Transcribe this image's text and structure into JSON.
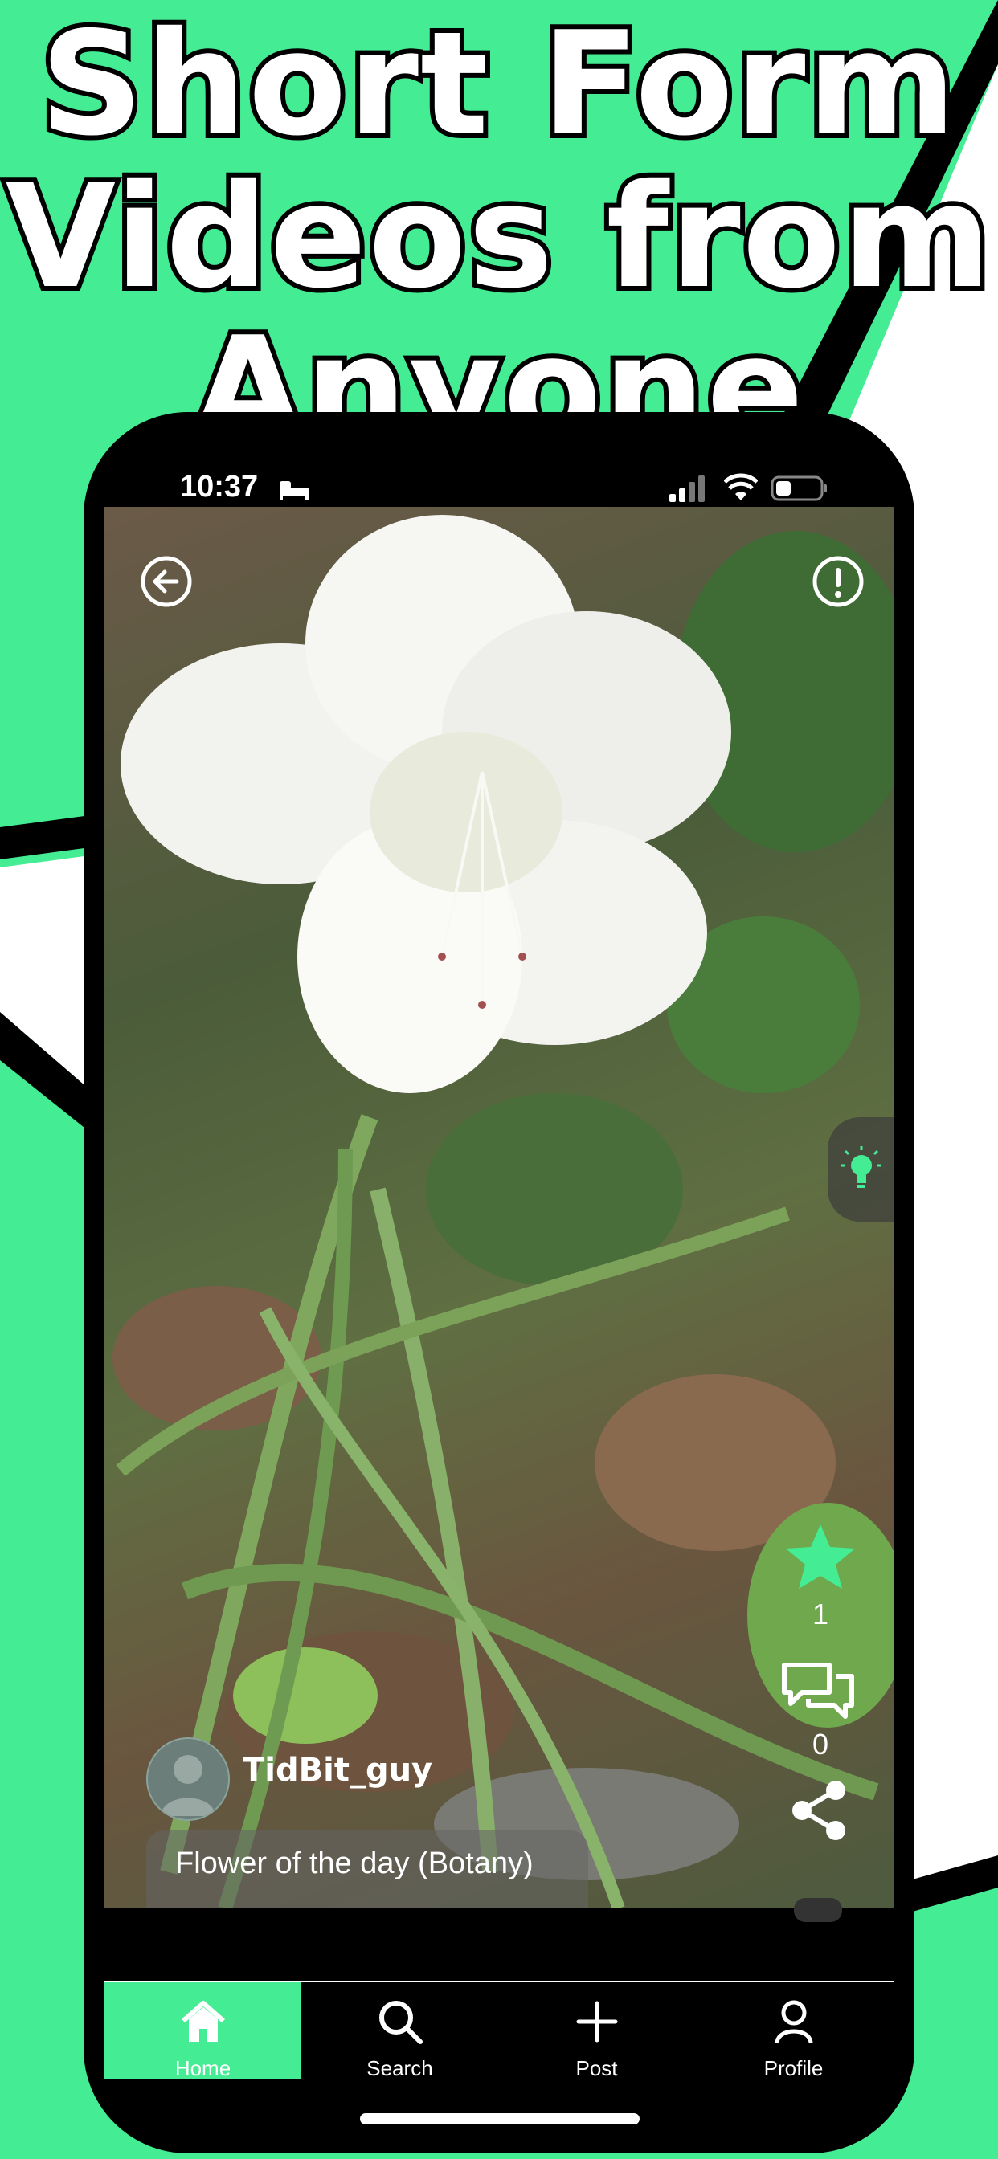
{
  "headline": [
    "Short Form",
    "Videos from",
    "Anyone"
  ],
  "status_bar": {
    "time": "10:37",
    "icons": [
      "bed-icon",
      "signal-icon",
      "wifi-icon",
      "battery-icon"
    ]
  },
  "video": {
    "subject": "white azalea flower",
    "back_icon": "back-arrow-icon",
    "report_icon": "report-icon",
    "side_tab_icon": "lightbulb-icon"
  },
  "actions": {
    "like_count": "1",
    "comment_count": "0",
    "icons": [
      "star-icon",
      "comment-icon",
      "share-icon"
    ]
  },
  "post": {
    "username": "TidBit_guy",
    "caption": "Flower of the day (Botany)"
  },
  "nav": {
    "items": [
      {
        "label": "Home",
        "icon": "home-icon",
        "active": true
      },
      {
        "label": "Search",
        "icon": "search-icon",
        "active": false
      },
      {
        "label": "Post",
        "icon": "plus-icon",
        "active": false
      },
      {
        "label": "Profile",
        "icon": "profile-icon",
        "active": false
      }
    ]
  },
  "colors": {
    "brand_green": "#44ec94",
    "black": "#000000",
    "white": "#ffffff"
  }
}
